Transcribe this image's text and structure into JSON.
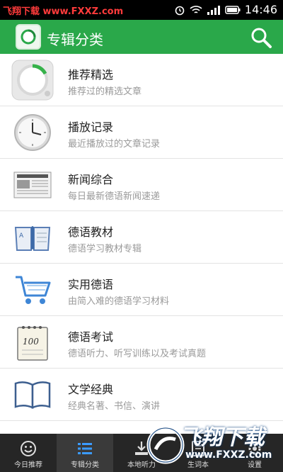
{
  "statusbar": {
    "watermark": "飞翔下载 www.FXXZ.com",
    "time": "14:46"
  },
  "appbar": {
    "title": "专辑分类",
    "accent": "#2aa84a"
  },
  "items": [
    {
      "title": "推荐精选",
      "subtitle": "推荐过的精选文章",
      "icon": "progress-dial-icon"
    },
    {
      "title": "播放记录",
      "subtitle": "最近播放过的文章记录",
      "icon": "clock-icon"
    },
    {
      "title": "新闻综合",
      "subtitle": "每日最新德语新闻速递",
      "icon": "newspaper-icon"
    },
    {
      "title": "德语教材",
      "subtitle": "德语学习教材专辑",
      "icon": "textbook-icon"
    },
    {
      "title": "实用德语",
      "subtitle": "由简入难的德语学习材料",
      "icon": "shopping-cart-icon"
    },
    {
      "title": "德语考试",
      "subtitle": "德语听力、听写训练以及考试真题",
      "icon": "exam-notepad-icon"
    },
    {
      "title": "文学经典",
      "subtitle": "经典名著、书信、演讲",
      "icon": "open-book-icon"
    }
  ],
  "tabs": [
    {
      "label": "今日推荐",
      "icon": "smiley-icon",
      "active": false
    },
    {
      "label": "专辑分类",
      "icon": "list-icon",
      "active": true
    },
    {
      "label": "本地听力",
      "icon": "download-icon",
      "active": false
    },
    {
      "label": "生词本",
      "icon": "notebook-icon",
      "active": false
    },
    {
      "label": "设置",
      "icon": "gear-icon",
      "active": false
    }
  ],
  "watermark": {
    "text": "飞翔下载",
    "url": "www.FXXZ.com"
  }
}
